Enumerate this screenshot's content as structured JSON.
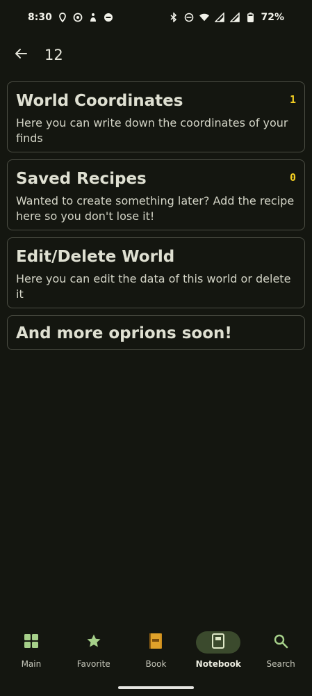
{
  "status_bar": {
    "time": "8:30",
    "battery_percent": "72%",
    "left_icons": [
      "location-icon",
      "radio-icon",
      "accessibility-icon",
      "dnd-icon"
    ],
    "right_icons": [
      "bluetooth-icon",
      "dnd-icon",
      "wifi-icon",
      "signal-icon",
      "signal-icon",
      "battery-icon"
    ]
  },
  "top_bar": {
    "back_icon": "arrow-left-icon",
    "title": "12"
  },
  "cards": [
    {
      "title": "World Coordinates",
      "description": "Here you can write down the coordinates of your finds",
      "count": "1"
    },
    {
      "title": "Saved Recipes",
      "description": "Wanted to create something later? Add the recipe here so you don't lose it!",
      "count": "0"
    },
    {
      "title": "Edit/Delete World",
      "description": "Here you can edit the data of this world or delete it"
    },
    {
      "title": "And more oprions soon!"
    }
  ],
  "bottom_nav": {
    "items": [
      {
        "label": "Main",
        "icon": "grid-icon",
        "active": false
      },
      {
        "label": "Favorite",
        "icon": "star-icon",
        "active": false
      },
      {
        "label": "Book",
        "icon": "book-icon",
        "active": false
      },
      {
        "label": "Notebook",
        "icon": "notebook-icon",
        "active": true
      },
      {
        "label": "Search",
        "icon": "search-icon",
        "active": false
      }
    ]
  },
  "colors": {
    "background": "#141610",
    "count_yellow": "#f4cf22",
    "nav_green": "#a6d08a",
    "active_pill": "#3b4a2d"
  }
}
